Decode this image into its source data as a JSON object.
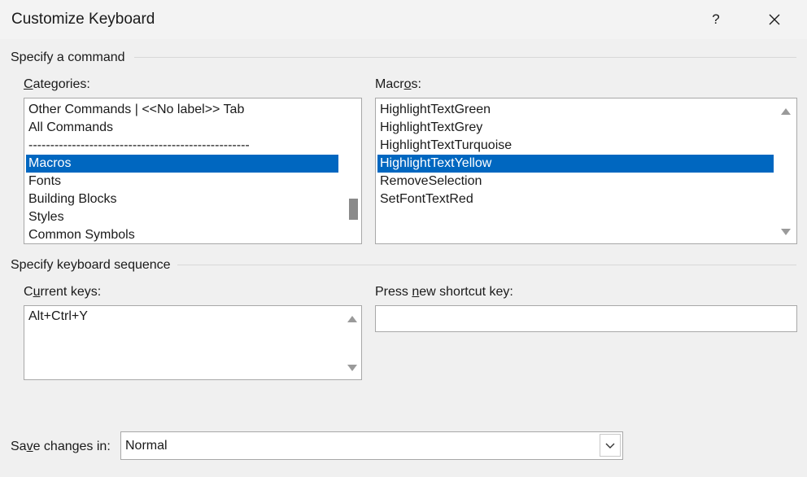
{
  "window": {
    "title": "Customize Keyboard",
    "help_label": "?",
    "close_label": "✕"
  },
  "command_section": {
    "legend": "Specify a command",
    "categories_label_accel": "C",
    "categories_label_rest": "ategories:",
    "categories": [
      "Other Commands | <<No label>> Tab",
      "All Commands",
      "---------------------------------------------------",
      "Macros",
      "Fonts",
      "Building Blocks",
      "Styles",
      "Common Symbols"
    ],
    "categories_selected": "Macros",
    "macros_label_pre": "Macr",
    "macros_label_accel": "o",
    "macros_label_post": "s:",
    "macros": [
      "HighlightTextGreen",
      "HighlightTextGrey",
      "HighlightTextTurquoise",
      "HighlightTextYellow",
      "RemoveSelection",
      "SetFontTextRed"
    ],
    "macros_selected": "HighlightTextYellow"
  },
  "keyboard_section": {
    "legend": "Specify keyboard sequence",
    "current_keys_pre": "C",
    "current_keys_accel": "u",
    "current_keys_post": "rrent keys:",
    "current_keys": [
      "Alt+Ctrl+Y"
    ],
    "new_key_pre": "Press ",
    "new_key_accel": "n",
    "new_key_post": "ew shortcut key:",
    "new_key_value": ""
  },
  "save": {
    "label_pre": "Sa",
    "label_accel": "v",
    "label_post": "e changes in:",
    "value": "Normal"
  },
  "icons": {
    "help": "question-mark-icon",
    "close": "close-icon",
    "dropdown": "chevron-down-icon"
  }
}
